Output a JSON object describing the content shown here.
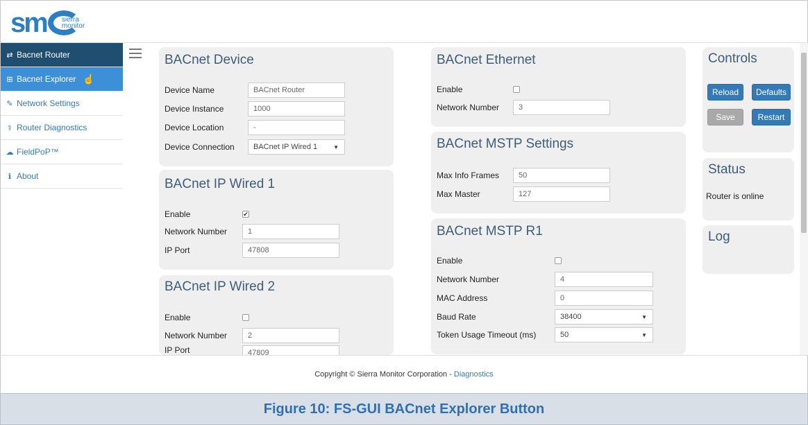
{
  "logo": {
    "letters": "sm",
    "sub1": "sierra",
    "sub2": "monitor"
  },
  "sidebar": {
    "items": [
      {
        "icon": "⇄",
        "label": "Bacnet Router"
      },
      {
        "icon": "⊞",
        "label": "Bacnet Explorer"
      },
      {
        "icon": "✎",
        "label": "Network Settings"
      },
      {
        "icon": "⚕",
        "label": "Router Diagnostics"
      },
      {
        "icon": "☁",
        "label": "FieldPoP™"
      },
      {
        "icon": "ℹ",
        "label": "About"
      }
    ]
  },
  "device": {
    "title": "BACnet Device",
    "name_label": "Device Name",
    "name_value": "BACnet Router",
    "instance_label": "Device Instance",
    "instance_value": "1000",
    "location_label": "Device Location",
    "location_value": "-",
    "connection_label": "Device Connection",
    "connection_value": "BACnet IP Wired 1"
  },
  "ip1": {
    "title": "BACnet IP Wired 1",
    "enable_label": "Enable",
    "enable_checked": true,
    "network_label": "Network Number",
    "network_value": "1",
    "port_label": "IP Port",
    "port_value": "47808"
  },
  "ip2": {
    "title": "BACnet IP Wired 2",
    "enable_label": "Enable",
    "enable_checked": false,
    "network_label": "Network Number",
    "network_value": "2",
    "port_label": "IP Port",
    "port_value": "47809"
  },
  "ethernet": {
    "title": "BACnet Ethernet",
    "enable_label": "Enable",
    "enable_checked": false,
    "network_label": "Network Number",
    "network_value": "3"
  },
  "mstp_settings": {
    "title": "BACnet MSTP Settings",
    "frames_label": "Max Info Frames",
    "frames_value": "50",
    "master_label": "Max Master",
    "master_value": "127"
  },
  "mstp_r1": {
    "title": "BACnet MSTP R1",
    "enable_label": "Enable",
    "enable_checked": false,
    "network_label": "Network Number",
    "network_value": "4",
    "mac_label": "MAC Address",
    "mac_value": "0",
    "baud_label": "Baud Rate",
    "baud_value": "38400",
    "timeout_label": "Token Usage Timeout (ms)",
    "timeout_value": "50"
  },
  "controls": {
    "title": "Controls",
    "reload": "Reload",
    "defaults": "Defaults",
    "save": "Save",
    "restart": "Restart"
  },
  "status": {
    "title": "Status",
    "text": "Router is online"
  },
  "log": {
    "title": "Log"
  },
  "footer": {
    "copyright": "Copyright © Sierra Monitor Corporation - ",
    "link": "Diagnostics"
  },
  "caption": "Figure 10: FS-GUI BACnet Explorer Button",
  "colors": {
    "nav_active": "#1f4e70",
    "nav_hover": "#3d8fd8",
    "accent": "#337ab7",
    "caption": "#2f6fb3"
  }
}
